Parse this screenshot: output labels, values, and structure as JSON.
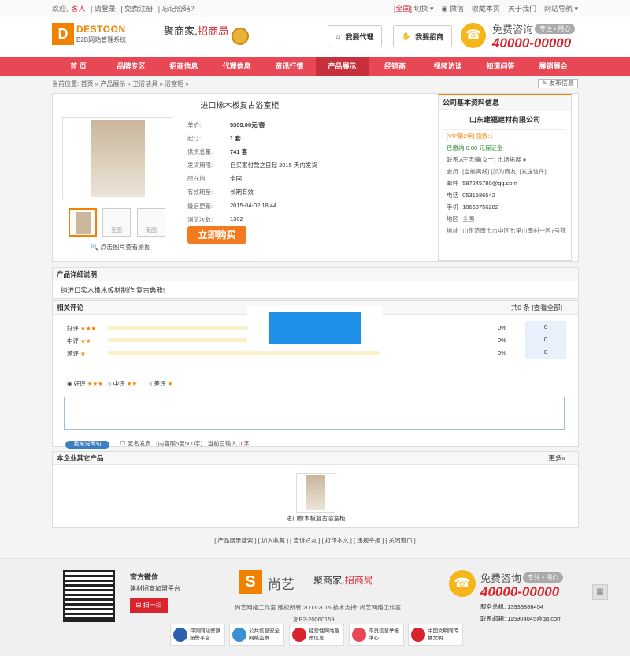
{
  "topbar": {
    "welcome": "欢迎,",
    "guest": "客人",
    "login": "请登录",
    "register": "免费注册",
    "forgot": "忘记密码?",
    "region": "[全国]",
    "switch": "切换",
    "wechat": "微信",
    "bookmark": "收藏本页",
    "about": "关于我们",
    "sitenav": "网站导航"
  },
  "header": {
    "logo_mark": "D",
    "logo_name": "DESTOON",
    "logo_sub": "B2B网站管理系统",
    "slogan_a": "聚商家,",
    "slogan_b": "招商局",
    "btn_agent": "我要代理",
    "btn_invest": "我要招商",
    "consult": "免费咨询",
    "consult_tag": "专注 • 用心",
    "hotline": "40000-00000"
  },
  "nav": [
    "首 页",
    "品牌专区",
    "招商信息",
    "代理信息",
    "资讯行情",
    "产品展示",
    "经销商",
    "视频访谈",
    "知道问答",
    "展销展会"
  ],
  "nav_active": 5,
  "breadcrumb": {
    "text": "当前位置: 首页 » 产品展示 » 卫浴洁具 » 浴室柜 »",
    "publish": "发布信息"
  },
  "product": {
    "title": "进口橡木板复古浴室柜",
    "specs": [
      {
        "k": "单价:",
        "v": "9399.00元/套"
      },
      {
        "k": "起订:",
        "v": "1 套"
      },
      {
        "k": "供货总量:",
        "v": "741 套"
      },
      {
        "k": "发货期限:",
        "v": "自买家付款之日起 2015 天内发货"
      },
      {
        "k": "所在地:",
        "v": "全国"
      },
      {
        "k": "有效期至:",
        "v": "长期有效"
      },
      {
        "k": "最后更新:",
        "v": "2015-04-02 18:44"
      },
      {
        "k": "浏览次数:",
        "v": "1302"
      }
    ],
    "thumb_empty": "无图",
    "zoom_hint": "点击图片查看原图",
    "buy": "立即购买"
  },
  "company": {
    "header": "公司基本资料信息",
    "name": "山东建福建材有限公司",
    "vip": "[VIP第2年] 指数:1",
    "deposit": "已缴纳 0.00 元保证金",
    "contact_k": "联系人",
    "contact_v": "王忠骗(女士) 市场拓展",
    "member_k": "会员",
    "member_v": "[当前离线] [加为商友] [发送信件]",
    "email_k": "邮件",
    "email_v": "587245780@qq.com",
    "phone_k": "电话",
    "phone_v": "0531586542",
    "mobile_k": "手机",
    "mobile_v": "18663756282",
    "area_k": "地区",
    "area_v": "全国",
    "addr_k": "地址",
    "addr_v": "山东济南市市中区七里山南村一区7号院"
  },
  "detail": {
    "header": "产品详细说明",
    "text": "纯进口实木橡木板材制作 复古典雅!"
  },
  "comments": {
    "header": "相关评论",
    "total_a": "共",
    "total_n": "0",
    "total_b": "条",
    "view_all": "[查看全部]",
    "good": "好评",
    "mid": "中评",
    "bad": "差评",
    "pct": "0%",
    "count": "0",
    "stars3": "★★★",
    "stars2": "★★",
    "stars1": "★",
    "submit": "我来说两句",
    "anon": "匿名发表",
    "limit_a": "(内容限5至500字)",
    "limit_b": "当前已输入",
    "limit_n": "0",
    "limit_c": "字"
  },
  "others": {
    "header": "本企业其它产品",
    "more": "更多»",
    "item_name": "进口橡木板复古浴室柜"
  },
  "actions": "[ 产品展示搜索 ] [ 加入收藏 ] [ 告诉好友 ] [ 打印本文 ] [ 违规举报 ] [ 关闭窗口 ]",
  "footer": {
    "wechat_title": "官方微信",
    "wechat_desc": "建材招商加盟平台",
    "scan": "扫一扫",
    "brand": "尚艺",
    "copyright": "尚艺网络工作室 版权所有 2000-2015 技术支持: 尚艺网络工作室",
    "icp": "浙B2-20060159",
    "consult": "免费咨询",
    "consult_tag": "专注 • 用心",
    "hotline": "40000-00000",
    "tel": "服务总机: 13933886454",
    "mail": "联系邮箱: 115904045@qq.com",
    "badges": [
      "评测网站警察报警平台",
      "公共信息安全网络监察",
      "经营性网站备案信息",
      "不良信息举报中心",
      "中国文明网传播文明"
    ]
  },
  "colors": {
    "brand_red": "#e84855",
    "accent_orange": "#f08200"
  }
}
